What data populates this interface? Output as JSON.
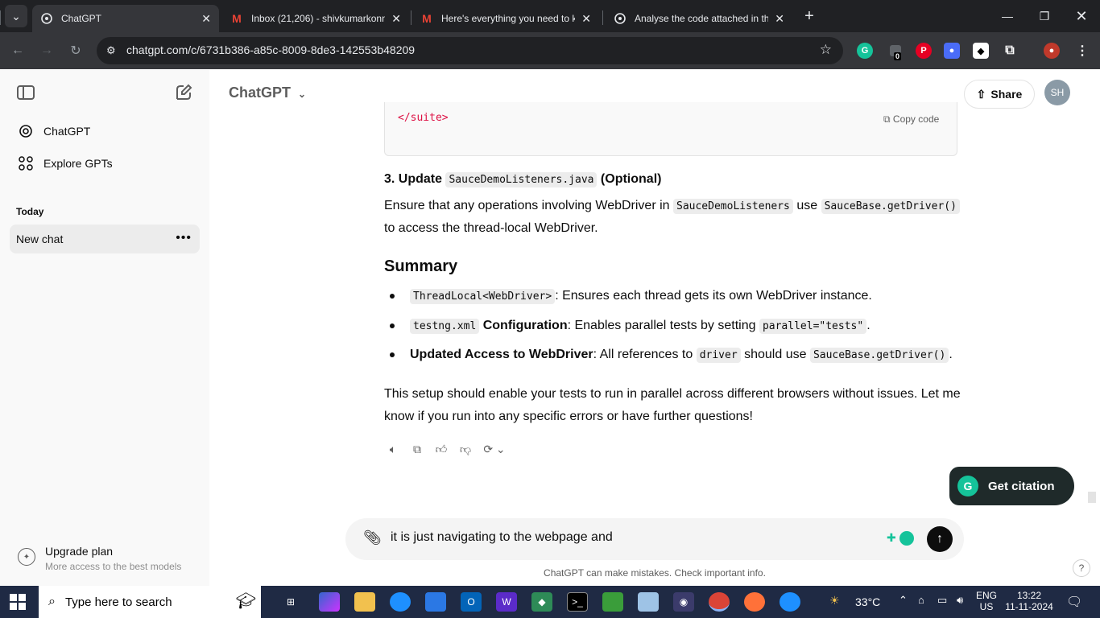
{
  "browser": {
    "tabs": [
      {
        "title": "ChatGPT",
        "active": true
      },
      {
        "title": "Inbox (21,206) - shivkumarkonn"
      },
      {
        "title": "Here's everything you need to k"
      },
      {
        "title": "Analyse the code attached in th"
      }
    ],
    "url": "chatgpt.com/c/6731b386-a85c-8009-8de3-142553b48209",
    "ext_badge": "0"
  },
  "sidebar": {
    "items": [
      {
        "label": "ChatGPT",
        "icon": "openai-logo-icon"
      },
      {
        "label": "Explore GPTs",
        "icon": "grid-icon"
      }
    ],
    "section_title": "Today",
    "chats": [
      {
        "label": "New chat"
      }
    ],
    "upgrade": {
      "title": "Upgrade plan",
      "subtitle": "More access to the best models"
    }
  },
  "header": {
    "model": "ChatGPT",
    "share": "Share",
    "avatar": "SH"
  },
  "conversation": {
    "code_tail": "</suite>",
    "copy_code": "Copy code",
    "step3": {
      "prefix": "3. Update ",
      "code": "SauceDemoListeners.java",
      "suffix": " (Optional)"
    },
    "p1": {
      "a": "Ensure that any operations involving WebDriver in ",
      "c1": "SauceDemoListeners",
      "b": " use ",
      "c2": "SauceBase.getDriver()",
      "line2": "to access the thread-local WebDriver."
    },
    "summary_heading": "Summary",
    "bullets": [
      {
        "code": "ThreadLocal<WebDriver>",
        "text": ": Ensures each thread gets its own WebDriver instance."
      },
      {
        "code": "testng.xml",
        "bold": " Configuration",
        "text": ": Enables parallel tests by setting ",
        "code2": "parallel=\"tests\"",
        "end": "."
      },
      {
        "bold": "Updated Access to WebDriver",
        "text": ": All references to ",
        "code": "driver",
        "mid": " should use ",
        "code2": "SauceBase.getDriver()",
        "end": "."
      }
    ],
    "closing_line1": "This setup should enable your tests to run in parallel across different browsers without issues. Let me",
    "closing_line2": "know if you run into any specific errors or have further questions!"
  },
  "composer": {
    "value": "it is just navigating to the webpage and",
    "disclaimer": "ChatGPT can make mistakes. Check important info."
  },
  "citation_button": "Get citation",
  "help": "?",
  "taskbar": {
    "search_placeholder": "Type here to search",
    "weather": "33°C",
    "lang_top": "ENG",
    "lang_bottom": "US",
    "time": "13:22",
    "date": "11-11-2024"
  }
}
